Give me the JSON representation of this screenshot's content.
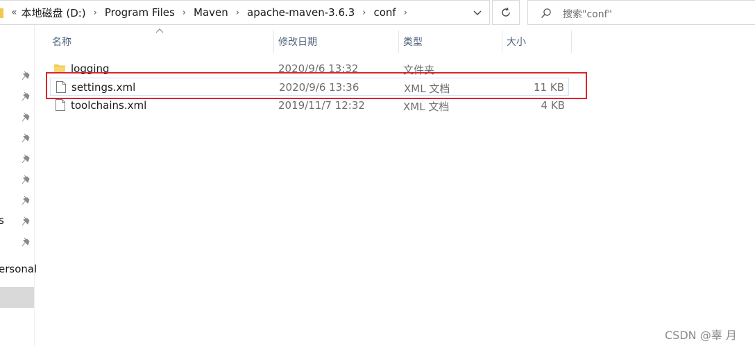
{
  "window": {
    "accent": "#d9252b",
    "selection_border": "#cfe3f7"
  },
  "address_bar": {
    "overflow_glyph": "«",
    "crumbs": [
      "本地磁盘 (D:)",
      "Program Files",
      "Maven",
      "apache-maven-3.6.3",
      "conf"
    ],
    "separator_glyph": "›",
    "dropdown_icon": "chevron-down-icon",
    "refresh_icon": "refresh-icon"
  },
  "search": {
    "placeholder": "搜索\"conf\"",
    "icon": "search-icon"
  },
  "nav_pane": {
    "pinned_count": 9,
    "visible_labels": [
      "s",
      "ersonal"
    ],
    "pin_icon": "pin-icon"
  },
  "columns": {
    "name": "名称",
    "date": "修改日期",
    "type": "类型",
    "size": "大小"
  },
  "files": [
    {
      "name": "logging",
      "date": "2020/9/6 13:32",
      "type": "文件夹",
      "size": "",
      "icon": "folder-icon"
    },
    {
      "name": "settings.xml",
      "date": "2020/9/6 13:36",
      "type": "XML 文档",
      "size": "11 KB",
      "icon": "document-icon"
    },
    {
      "name": "toolchains.xml",
      "date": "2019/11/7 12:32",
      "type": "XML 文档",
      "size": "4 KB",
      "icon": "document-icon"
    }
  ],
  "watermark": "CSDN @辜 月"
}
